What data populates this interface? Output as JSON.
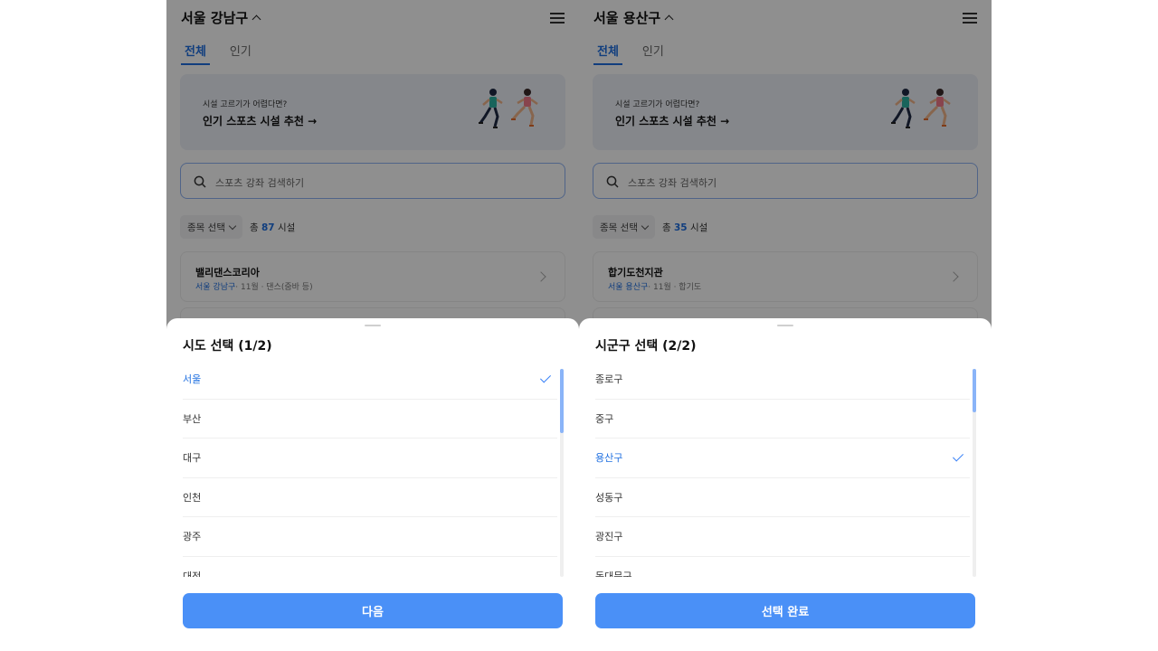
{
  "colors": {
    "accent": "#1f6fe0",
    "button": "#4a90f7",
    "dim_overlay": "rgba(0,0,0,0.44)"
  },
  "icons": {
    "menu": "hamburger-icon",
    "search": "search-icon",
    "check": "check-icon"
  },
  "screens": [
    {
      "header": {
        "region_title": "서울 강남구"
      },
      "tabs": [
        {
          "label": "전체"
        },
        {
          "label": "인기"
        }
      ],
      "banner": {
        "sub": "시설 고르기가 어렵다면?",
        "main": "인기 스포츠 시설 추천 →"
      },
      "search": {
        "placeholder": "스포츠 강좌 검색하기"
      },
      "filter": {
        "chip_label": "종목 선택",
        "count_prefix": "총",
        "count": "87",
        "count_suffix": "시설"
      },
      "card": {
        "title": "밸리댄스코리아",
        "location": "서울 강남구",
        "meta": "· 11월 · 댄스(줌바 등)"
      },
      "sheet": {
        "title": "시도 선택 (1/2)",
        "options": [
          "서울",
          "부산",
          "대구",
          "인천",
          "광주",
          "대전"
        ],
        "selected": "서울",
        "scroll_fraction": {
          "start": 0.0,
          "size": 0.31
        },
        "button_label": "다음"
      }
    },
    {
      "header": {
        "region_title": "서울 용산구"
      },
      "tabs": [
        {
          "label": "전체"
        },
        {
          "label": "인기"
        }
      ],
      "banner": {
        "sub": "시설 고르기가 어렵다면?",
        "main": "인기 스포츠 시설 추천 →"
      },
      "search": {
        "placeholder": "스포츠 강좌 검색하기"
      },
      "filter": {
        "chip_label": "종목 선택",
        "count_prefix": "총",
        "count": "35",
        "count_suffix": "시설"
      },
      "card": {
        "title": "합기도천지관",
        "location": "서울 용산구",
        "meta": "· 11월 · 합기도"
      },
      "sheet": {
        "title": "시군구 선택 (2/2)",
        "options": [
          "종로구",
          "중구",
          "용산구",
          "성동구",
          "광진구",
          "동대문구"
        ],
        "selected": "용산구",
        "scroll_fraction": {
          "start": 0.0,
          "size": 0.21
        },
        "button_label": "선택 완료"
      }
    }
  ]
}
